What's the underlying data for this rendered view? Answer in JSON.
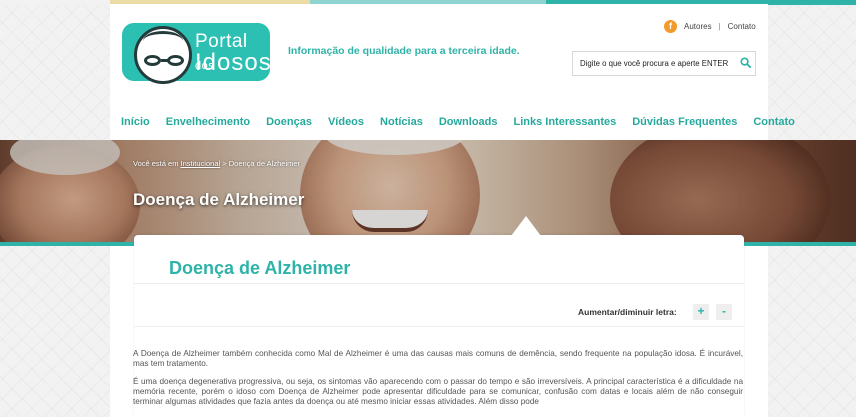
{
  "header": {
    "logo": {
      "line1": "Portal",
      "line1_small": "dos",
      "line2": "Idosos"
    },
    "tagline": "Informação de qualidade para a terceira idade.",
    "toplinks": [
      {
        "label": "Autores"
      },
      {
        "label": "Contato"
      }
    ],
    "facebook_icon": "f",
    "search": {
      "placeholder": "Digite o que você procura e aperte ENTER"
    }
  },
  "nav": {
    "items": [
      {
        "label": "Início"
      },
      {
        "label": "Envelhecimento"
      },
      {
        "label": "Doenças"
      },
      {
        "label": "Vídeos"
      },
      {
        "label": "Notícias"
      },
      {
        "label": "Downloads"
      },
      {
        "label": "Links Interessantes"
      },
      {
        "label": "Dúvidas Frequentes"
      },
      {
        "label": "Contato"
      }
    ]
  },
  "banner": {
    "breadcrumb_prefix": "Você está em",
    "breadcrumb_link": "Institucional",
    "breadcrumb_sep": ">",
    "breadcrumb_current": "Doença de Alzheimer",
    "title": "Doença de Alzheimer"
  },
  "article": {
    "title": "Doença de Alzheimer",
    "font_control_label": "Aumentar/diminuir letra:",
    "increase_label": "+",
    "decrease_label": "-",
    "paragraphs": [
      "A Doença de Alzheimer também conhecida como Mal de Alzheimer é uma das causas mais comuns de demência, sendo frequente na população idosa. É incurável, mas tem tratamento.",
      "É uma doença degenerativa progressiva, ou seja, os sintomas vão aparecendo com o passar do tempo e são irreversíveis. A principal característica é a dificuldade na memória recente, porém o idoso com Doença de Alzheimer pode apresentar dificuldade para se comunicar, confusão com datas e locais além de não conseguir terminar algumas atividades que fazia antes da doença ou até mesmo iniciar essas atividades. Além disso pode"
    ]
  },
  "colors": {
    "accent": "#2fb3a8",
    "icon_orange": "#f29a2e"
  }
}
